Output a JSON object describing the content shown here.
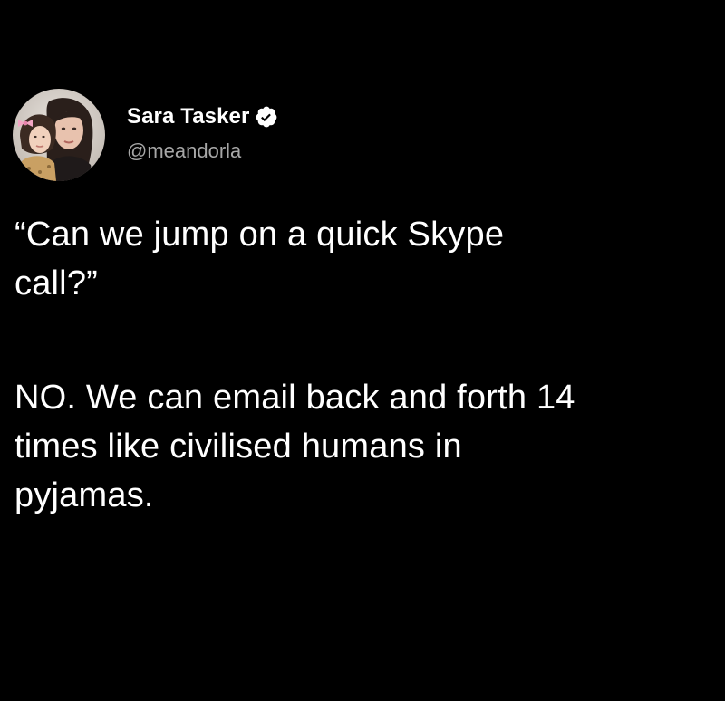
{
  "tweet": {
    "author": {
      "display_name": "Sara Tasker",
      "handle": "@meandorla",
      "verified": true,
      "avatar_icon": "profile-photo"
    },
    "text": {
      "paragraph_1": "“Can we jump on a quick Skype\ncall?”",
      "paragraph_2": "NO. We can email back and forth 14\ntimes like civilised humans in\npyjamas."
    }
  },
  "colors": {
    "background": "#000000",
    "text_primary": "#ffffff",
    "text_secondary": "#a7a7a7",
    "verified_badge": "#ffffff"
  }
}
